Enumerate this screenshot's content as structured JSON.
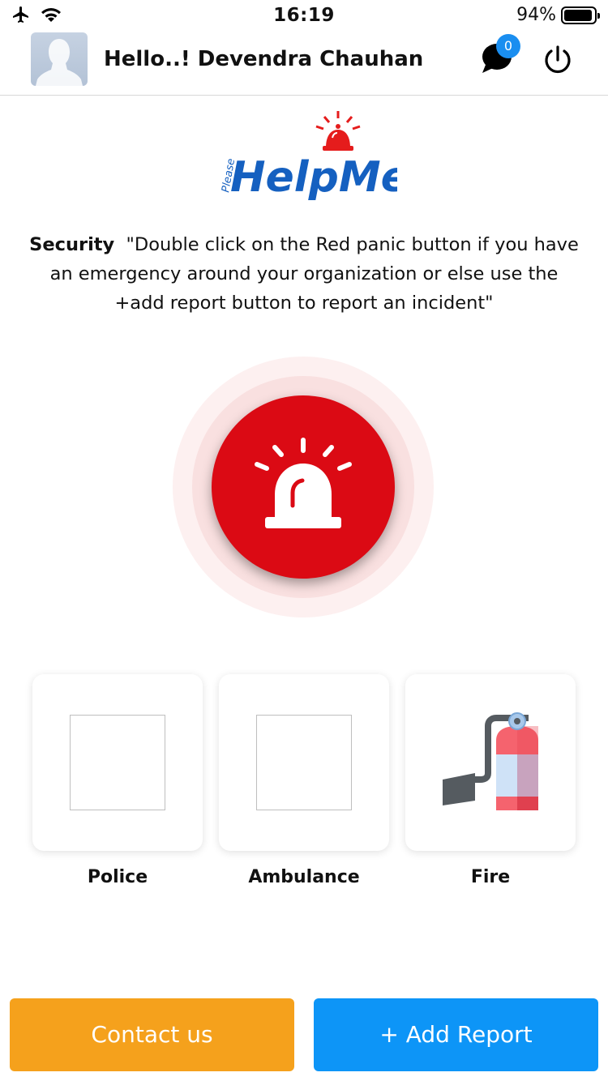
{
  "status_bar": {
    "time": "16:19",
    "battery_percent_text": "94%",
    "battery_level": 0.94,
    "icons": [
      "airplane-icon",
      "wifi-icon",
      "battery-icon"
    ]
  },
  "header": {
    "greeting": "Hello..! Devendra Chauhan",
    "chat_badge_count": "0",
    "icons": [
      "avatar",
      "chat-icon",
      "power-icon"
    ]
  },
  "logo": {
    "text_small": "Please",
    "text_main": "HelpMe",
    "brand_color": "#1560c0",
    "accent_color": "#e51c1c"
  },
  "message": {
    "heading": "Security",
    "body": "\"Double click on the Red panic button if you have an emergency around your organization or else use the +add report button to report an incident\""
  },
  "panic": {
    "color": "#db0a14",
    "icon": "siren-icon"
  },
  "services": [
    {
      "label": "Police",
      "icon": "placeholder-image"
    },
    {
      "label": "Ambulance",
      "icon": "placeholder-image"
    },
    {
      "label": "Fire",
      "icon": "fire-extinguisher-icon"
    }
  ],
  "buttons": {
    "contact_label": "Contact us",
    "contact_color": "#f5a11c",
    "add_report_label": "+ Add Report",
    "add_report_color": "#0d95f7"
  }
}
